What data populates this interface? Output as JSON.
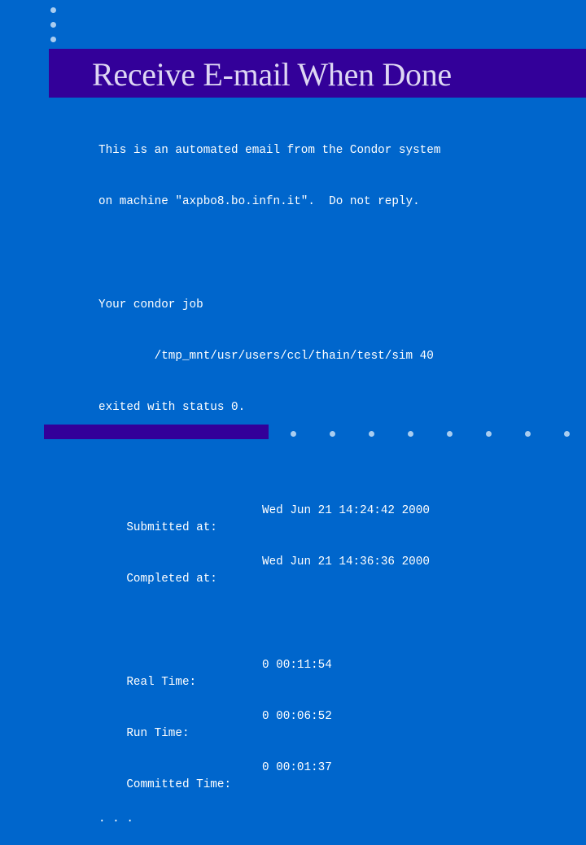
{
  "slide": {
    "title": "Receive E-mail When Done",
    "intro": [
      "This is an automated email from the Condor system",
      "on machine \"axpbo8.bo.infn.it\".  Do not reply."
    ],
    "job": [
      "Your condor job",
      "        /tmp_mnt/usr/users/ccl/thain/test/sim 40",
      "exited with status 0."
    ],
    "timestamps": [
      {
        "label": "Submitted at:",
        "value": "Wed Jun 21 14:24:42 2000"
      },
      {
        "label": "Completed at:",
        "value": "Wed Jun 21 14:36:36 2000"
      }
    ],
    "times": [
      {
        "label": "Real Time:",
        "value": "0 00:11:54"
      },
      {
        "label": "Run Time:",
        "value": "0 00:06:52"
      },
      {
        "label": "Committed Time:",
        "value": "0 00:01:37"
      }
    ],
    "ellipsis": ". . ."
  },
  "colors": {
    "background": "#0066cc",
    "title_bar": "#330099",
    "title_text": "#ddd6f3",
    "dots": "#a9cdf0"
  }
}
